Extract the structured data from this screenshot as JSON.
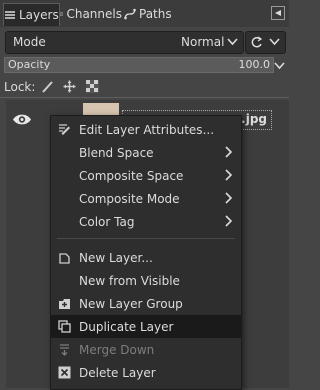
{
  "tabs": [
    {
      "label": "Layers",
      "icon": "layers-icon",
      "active": true
    },
    {
      "label": "Channels",
      "icon": "channels-icon",
      "active": false
    },
    {
      "label": "Paths",
      "icon": "paths-icon",
      "active": false
    }
  ],
  "mode": {
    "label": "Mode",
    "value": "Normal"
  },
  "opacity": {
    "label": "Opacity",
    "value": "100.0"
  },
  "lock": {
    "label": "Lock:"
  },
  "layer": {
    "name_visible": ".jpg"
  },
  "menu": {
    "items": [
      {
        "label": "Edit Layer Attributes...",
        "icon": "edit-attributes-icon",
        "submenu": false,
        "disabled": false,
        "highlight": false
      },
      {
        "label": "Blend Space",
        "icon": "",
        "submenu": true,
        "disabled": false,
        "highlight": false
      },
      {
        "label": "Composite Space",
        "icon": "",
        "submenu": true,
        "disabled": false,
        "highlight": false
      },
      {
        "label": "Composite Mode",
        "icon": "",
        "submenu": true,
        "disabled": false,
        "highlight": false
      },
      {
        "label": "Color Tag",
        "icon": "",
        "submenu": true,
        "disabled": false,
        "highlight": false
      },
      {
        "label": "New Layer...",
        "icon": "new-layer-icon",
        "submenu": false,
        "disabled": false,
        "highlight": false
      },
      {
        "label": "New from Visible",
        "icon": "",
        "submenu": false,
        "disabled": false,
        "highlight": false
      },
      {
        "label": "New Layer Group",
        "icon": "new-layer-group-icon",
        "submenu": false,
        "disabled": false,
        "highlight": false
      },
      {
        "label": "Duplicate Layer",
        "icon": "duplicate-layer-icon",
        "submenu": false,
        "disabled": false,
        "highlight": true
      },
      {
        "label": "Merge Down",
        "icon": "merge-down-icon",
        "submenu": false,
        "disabled": true,
        "highlight": false
      },
      {
        "label": "Delete Layer",
        "icon": "delete-layer-icon",
        "submenu": false,
        "disabled": false,
        "highlight": false
      }
    ]
  }
}
